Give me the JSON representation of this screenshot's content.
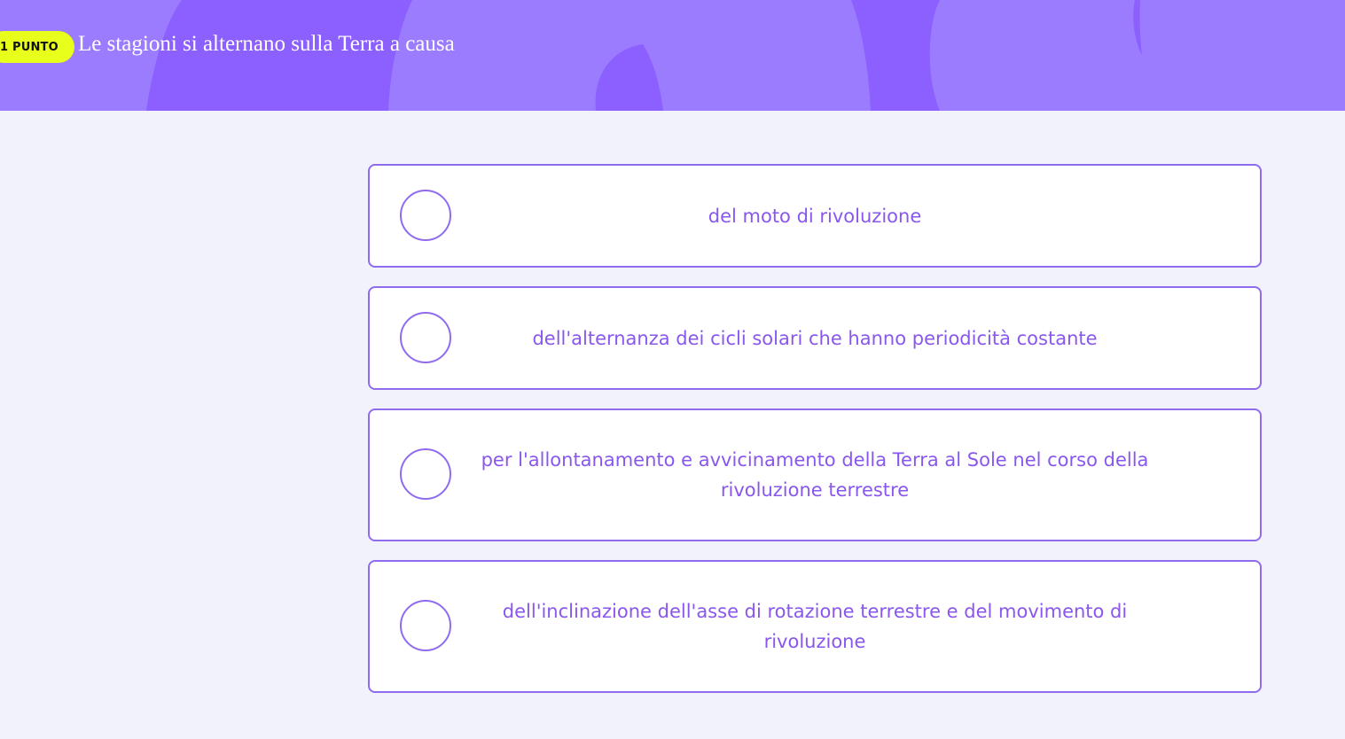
{
  "header": {
    "points_badge": "1 PUNTO",
    "question": "Le stagioni si alternano sulla Terra a causa"
  },
  "options": [
    {
      "label": "del moto di rivoluzione",
      "selected": false
    },
    {
      "label": "dell'alternanza dei cicli solari che hanno periodicità costante",
      "selected": false
    },
    {
      "label": "per l'allontanamento e avvicinamento della Terra al Sole nel corso della rivoluzione terrestre",
      "selected": false
    },
    {
      "label": "dell'inclinazione dell'asse di rotazione terrestre e del movimento di rivoluzione",
      "selected": false
    }
  ],
  "colors": {
    "header_bg": "#9b7cff",
    "header_shape": "#8c5fff",
    "badge": "#e7ff1a",
    "accent": "#8f6bf0",
    "page_bg": "#f2f2fa"
  }
}
